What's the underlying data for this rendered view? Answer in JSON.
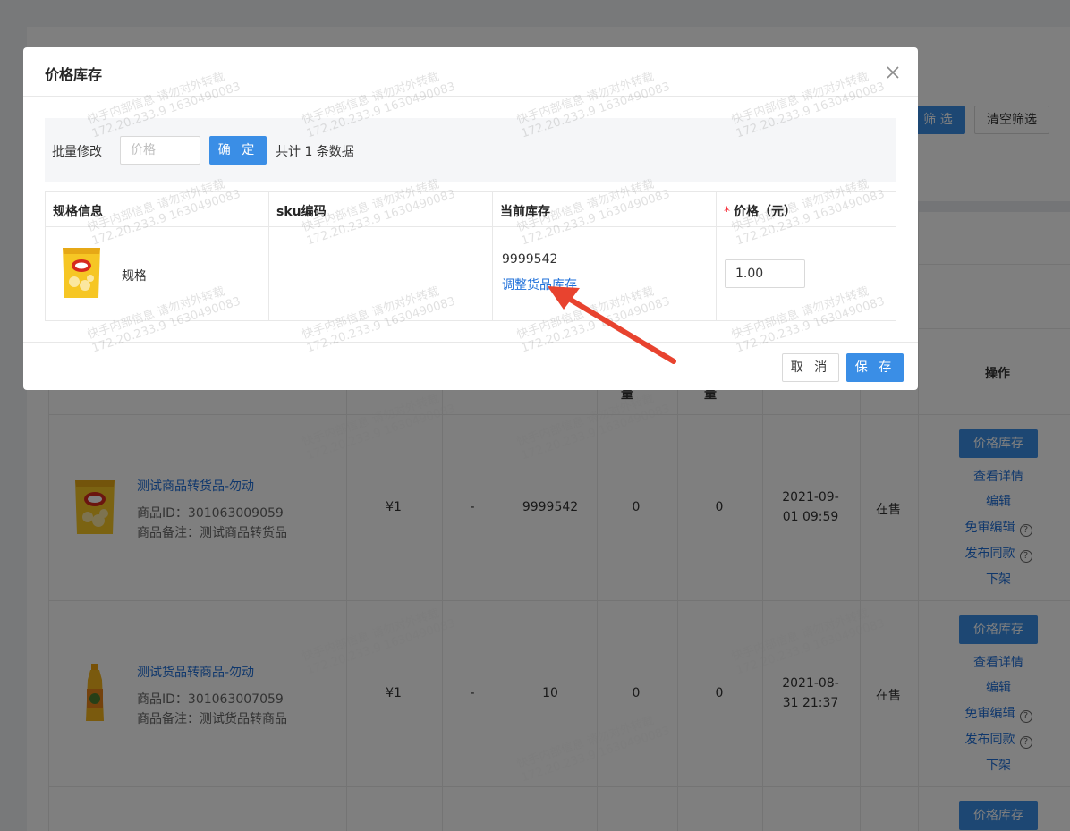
{
  "background": {
    "filter_button": "筛 选",
    "clear_filter_button": "清空筛选",
    "table": {
      "header_fragment_1": "量",
      "header_fragment_2": "量",
      "operation_header": "操作",
      "rows": [
        {
          "name": "测试商品转货品-勿动",
          "id_text": "商品ID：301063009059",
          "note_text": "商品备注：测试商品转货品",
          "price": "¥1",
          "dash": "-",
          "stock": "9999542",
          "col_a": "0",
          "col_b": "0",
          "time_line1": "2021-09-",
          "time_line2": "01 09:59",
          "status": "在售",
          "image": "chips-bag-icon"
        },
        {
          "name": "测试货品转商品-勿动",
          "id_text": "商品ID：301063007059",
          "note_text": "商品备注：测试货品转商品",
          "price": "¥1",
          "dash": "-",
          "stock": "10",
          "col_a": "0",
          "col_b": "0",
          "time_line1": "2021-08-",
          "time_line2": "31 21:37",
          "status": "在售",
          "image": "juice-bottle-icon"
        }
      ],
      "ops": {
        "price_stock": "价格库存",
        "view_detail": "查看详情",
        "edit": "编辑",
        "exempt_edit": "免审编辑",
        "publish_same": "发布同款",
        "off_shelf": "下架"
      }
    }
  },
  "modal": {
    "title": "价格库存",
    "close_icon": "close-icon",
    "batch": {
      "label": "批量修改",
      "input_placeholder": "价格",
      "confirm_button": "确 定",
      "count_text": "共计 1 条数据"
    },
    "table": {
      "headers": {
        "spec": "规格信息",
        "sku": "sku编码",
        "stock": "当前库存",
        "price_star": "*",
        "price": "价格（元）"
      },
      "row": {
        "spec_name": "规格",
        "sku": "",
        "stock": "9999542",
        "adjust_link": "调整货品库存",
        "price_value": "1.00"
      }
    },
    "footer": {
      "cancel_button": "取 消",
      "save_button": "保 存"
    }
  },
  "watermark": {
    "line1": "快手内部信息 请勿对外转载",
    "line2": "172.20.233.9 1630490083"
  },
  "colors": {
    "primary": "#3a8ee6",
    "link": "#1e6fd9",
    "annotation_arrow": "#e8432f"
  }
}
